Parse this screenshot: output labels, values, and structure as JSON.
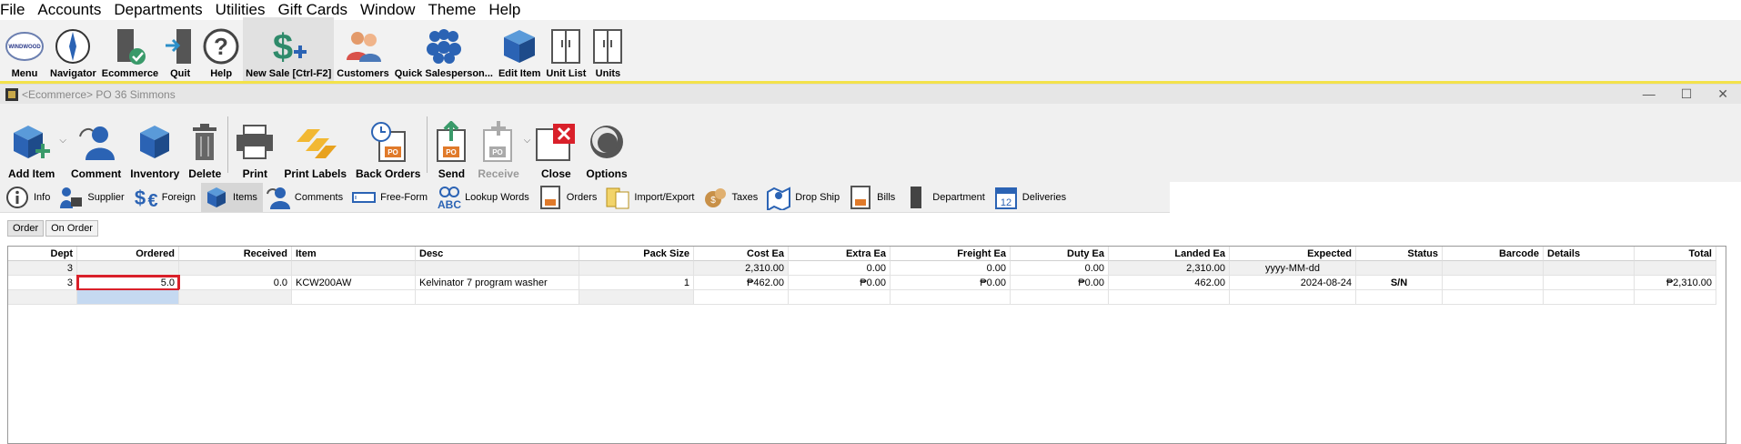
{
  "menu": [
    "File",
    "Accounts",
    "Departments",
    "Utilities",
    "Gift Cards",
    "Window",
    "Theme",
    "Help"
  ],
  "toolbar": [
    {
      "label": "Menu",
      "icon": "windwood-logo-icon"
    },
    {
      "label": "Navigator",
      "icon": "compass-icon"
    },
    {
      "label": "Ecommerce",
      "icon": "door-check-icon"
    },
    {
      "label": "Quit",
      "icon": "exit-door-icon"
    },
    {
      "label": "Help",
      "icon": "question-icon"
    },
    {
      "label": "New Sale [Ctrl-F2]",
      "icon": "dollar-plus-icon"
    },
    {
      "label": "Customers",
      "icon": "customers-icon"
    },
    {
      "label": "Quick Salesperson...",
      "icon": "people-group-icon"
    },
    {
      "label": "Edit Item",
      "icon": "box-icon"
    },
    {
      "label": "Unit List",
      "icon": "cabinet-icon"
    },
    {
      "label": "Units",
      "icon": "cabinet-icon"
    }
  ],
  "window": {
    "title": "<Ecommerce> PO 36 Simmons"
  },
  "doc_toolbar": [
    {
      "label": "Add Item",
      "icon": "add-box-icon"
    },
    {
      "label": "Comment",
      "icon": "comment-person-icon"
    },
    {
      "label": "Inventory",
      "icon": "box-icon"
    },
    {
      "label": "Delete",
      "icon": "trash-icon"
    },
    {
      "label": "Print",
      "icon": "printer-icon"
    },
    {
      "label": "Print Labels",
      "icon": "labels-icon"
    },
    {
      "label": "Back Orders",
      "icon": "po-clock-icon"
    },
    {
      "label": "Send",
      "icon": "po-send-icon"
    },
    {
      "label": "Receive",
      "icon": "po-receive-icon"
    },
    {
      "label": "Close",
      "icon": "close-icon"
    },
    {
      "label": "Options",
      "icon": "options-icon"
    }
  ],
  "tabs": [
    {
      "label": "Info",
      "icon": "info-icon"
    },
    {
      "label": "Supplier",
      "icon": "supplier-icon"
    },
    {
      "label": "Foreign",
      "icon": "currency-icon"
    },
    {
      "label": "Items",
      "icon": "box-icon"
    },
    {
      "label": "Comments",
      "icon": "comment-person-icon"
    },
    {
      "label": "Free-Form",
      "icon": "freeform-icon"
    },
    {
      "label": "Lookup Words",
      "icon": "abc-icon"
    },
    {
      "label": "Orders",
      "icon": "orders-icon"
    },
    {
      "label": "Import/Export",
      "icon": "import-export-icon"
    },
    {
      "label": "Taxes",
      "icon": "taxes-icon"
    },
    {
      "label": "Drop Ship",
      "icon": "map-pin-icon"
    },
    {
      "label": "Bills",
      "icon": "bill-icon"
    },
    {
      "label": "Department",
      "icon": "department-icon"
    },
    {
      "label": "Deliveries",
      "icon": "calendar-icon"
    }
  ],
  "subtabs": [
    "Order",
    "On Order"
  ],
  "grid": {
    "columns": [
      "Dept",
      "Ordered",
      "Received",
      "Item",
      "Desc",
      "Pack Size",
      "Cost Ea",
      "Extra Ea",
      "Freight Ea",
      "Duty Ea",
      "Landed Ea",
      "Expected",
      "Status",
      "Barcode",
      "Details",
      "Total"
    ],
    "rows": [
      [
        "3",
        "",
        "",
        "",
        "",
        "",
        "2,310.00",
        "0.00",
        "0.00",
        "0.00",
        "2,310.00",
        "yyyy-MM-dd",
        "",
        "",
        "",
        ""
      ],
      [
        "3",
        "5.0",
        "0.0",
        "KCW200AW",
        "Kelvinator 7 program washer",
        "1",
        "₱462.00",
        "₱0.00",
        "₱0.00",
        "₱0.00",
        "462.00",
        "2024-08-24",
        "S/N",
        "",
        "",
        "₱2,310.00"
      ],
      [
        "",
        "",
        "",
        "",
        "",
        "",
        "",
        "",
        "",
        "",
        "",
        "",
        "",
        "",
        "",
        ""
      ]
    ]
  }
}
